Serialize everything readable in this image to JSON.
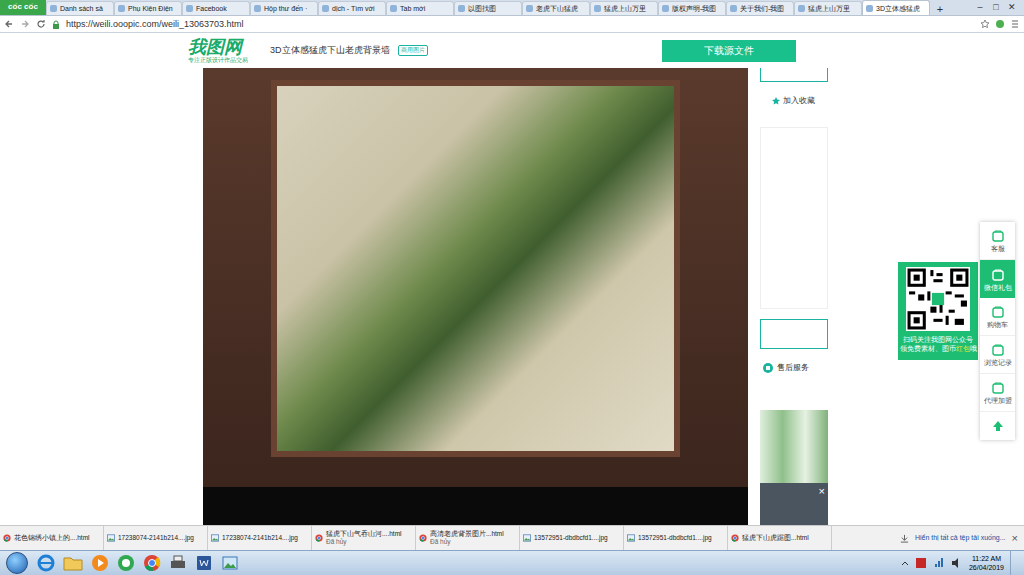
{
  "browser": {
    "brand": "cốc cốc",
    "tabs": [
      {
        "label": "Danh sách sả",
        "selected": false
      },
      {
        "label": "Phụ Kiện Điện",
        "selected": false
      },
      {
        "label": "Facebook",
        "selected": false
      },
      {
        "label": "Hộp thư đến ·",
        "selected": false
      },
      {
        "label": "dịch - Tìm với",
        "selected": false
      },
      {
        "label": "Tab mới",
        "selected": false
      },
      {
        "label": "以图找图",
        "selected": false
      },
      {
        "label": "老虎下山猛虎",
        "selected": false
      },
      {
        "label": "猛虎上山万里",
        "selected": false
      },
      {
        "label": "版权声明-我图",
        "selected": false
      },
      {
        "label": "关于我们-我图",
        "selected": false
      },
      {
        "label": "猛虎上山万里",
        "selected": false
      },
      {
        "label": "3D立体感猛虎",
        "selected": true
      }
    ],
    "new_tab": "+",
    "window_controls": [
      "–",
      "□",
      "✕"
    ],
    "url": "https://weili.ooopic.com/weili_13063703.html"
  },
  "site": {
    "logo": "我图网",
    "slogan": "专注正版设计作品交易",
    "title": "3D立体感猛虎下山老虎背景墙",
    "badge": "商用图片",
    "download_button": "下载源文件"
  },
  "right_panel": {
    "favorite": "加入收藏",
    "service": "售后服务",
    "popup_close": "×"
  },
  "float_bar": {
    "items": [
      {
        "label": "客服",
        "selected": false
      },
      {
        "label": "微信礼包",
        "selected": true
      },
      {
        "label": "购物车",
        "selected": false
      },
      {
        "label": "浏览记录",
        "selected": false
      },
      {
        "label": "代理加盟",
        "selected": false
      }
    ],
    "qr_line1": "扫码关注我图网公众号",
    "qr_line2": [
      {
        "text": "领免费素材、图币",
        "highlight": false
      },
      {
        "text": "红包",
        "highlight": true
      },
      {
        "text": "哦",
        "highlight": false
      }
    ]
  },
  "downloads": {
    "items": [
      {
        "name": "花色锦绣小镇上的....html",
        "kind": "html"
      },
      {
        "name": "17238074-2141b214....jpg",
        "kind": "jpg"
      },
      {
        "name": "17238074-2141b214....jpg",
        "kind": "jpg"
      },
      {
        "name": "猛虎下山气吞山河....html",
        "kind": "html",
        "status": "Đã hủy"
      },
      {
        "name": "高清老虎背景图片...html",
        "kind": "html",
        "status": "Đã hủy"
      },
      {
        "name": "13572951-dbdbcfd1....jpg",
        "kind": "jpg"
      },
      {
        "name": "13572951-dbdbcfd1....jpg",
        "kind": "jpg"
      },
      {
        "name": "猛虎下山虎踞图...html",
        "kind": "html"
      }
    ],
    "show_all": "Hiển thị tất cả tệp tải xuống...",
    "close": "×"
  },
  "taskbar": {
    "time": "11:22 AM",
    "date": "26/04/2019"
  }
}
